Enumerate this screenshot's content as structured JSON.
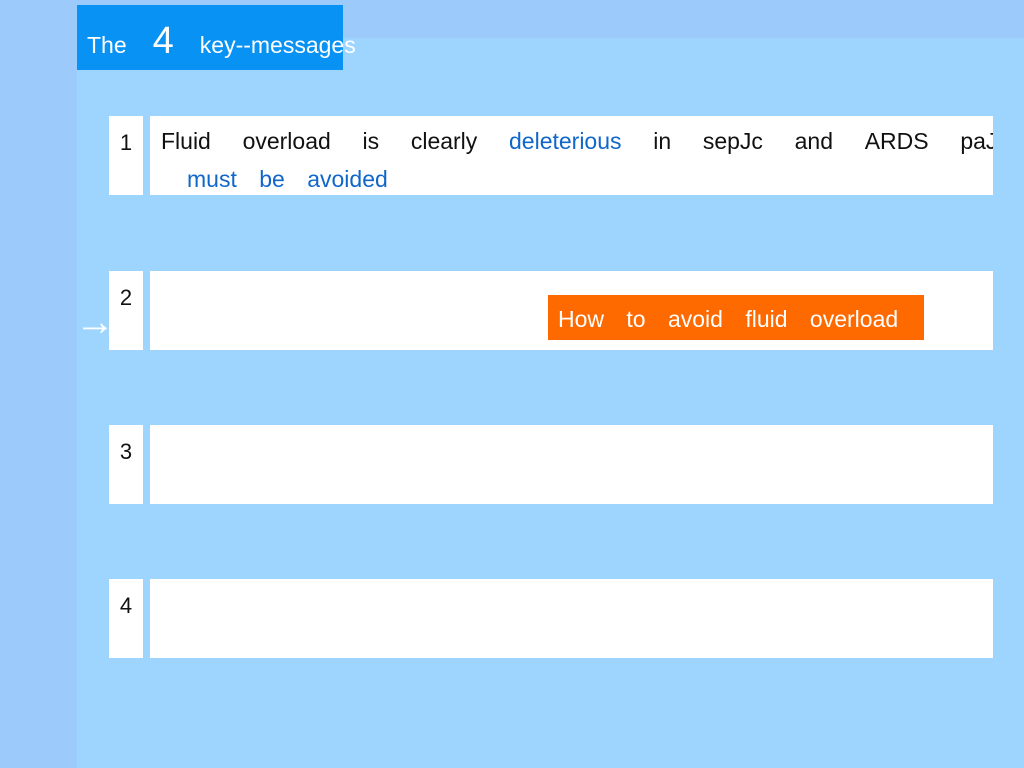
{
  "title": {
    "word1": "The",
    "number": "4",
    "word2": "key--messages"
  },
  "rows": [
    {
      "number": "1",
      "line1": {
        "w1": "Fluid",
        "w2": "overload",
        "w3": "is",
        "w4": "clearly",
        "w5": "deleterious",
        "w6": "in",
        "w7": "sepJc",
        "w8": "and",
        "w9": "ARDS",
        "w10": "paJents"
      },
      "line2": "must be avoided"
    },
    {
      "number": "2",
      "callout": "How to avoid fluid overload"
    },
    {
      "number": "3"
    },
    {
      "number": "4"
    }
  ],
  "pointer": {
    "icon": "arrow-right-icon",
    "glyph": "→"
  },
  "colors": {
    "background": "#9ccbfb",
    "panel": "#9dd5ff",
    "title_box": "#0892f4",
    "highlight_text": "#1167c9",
    "callout": "#ff6a00"
  }
}
